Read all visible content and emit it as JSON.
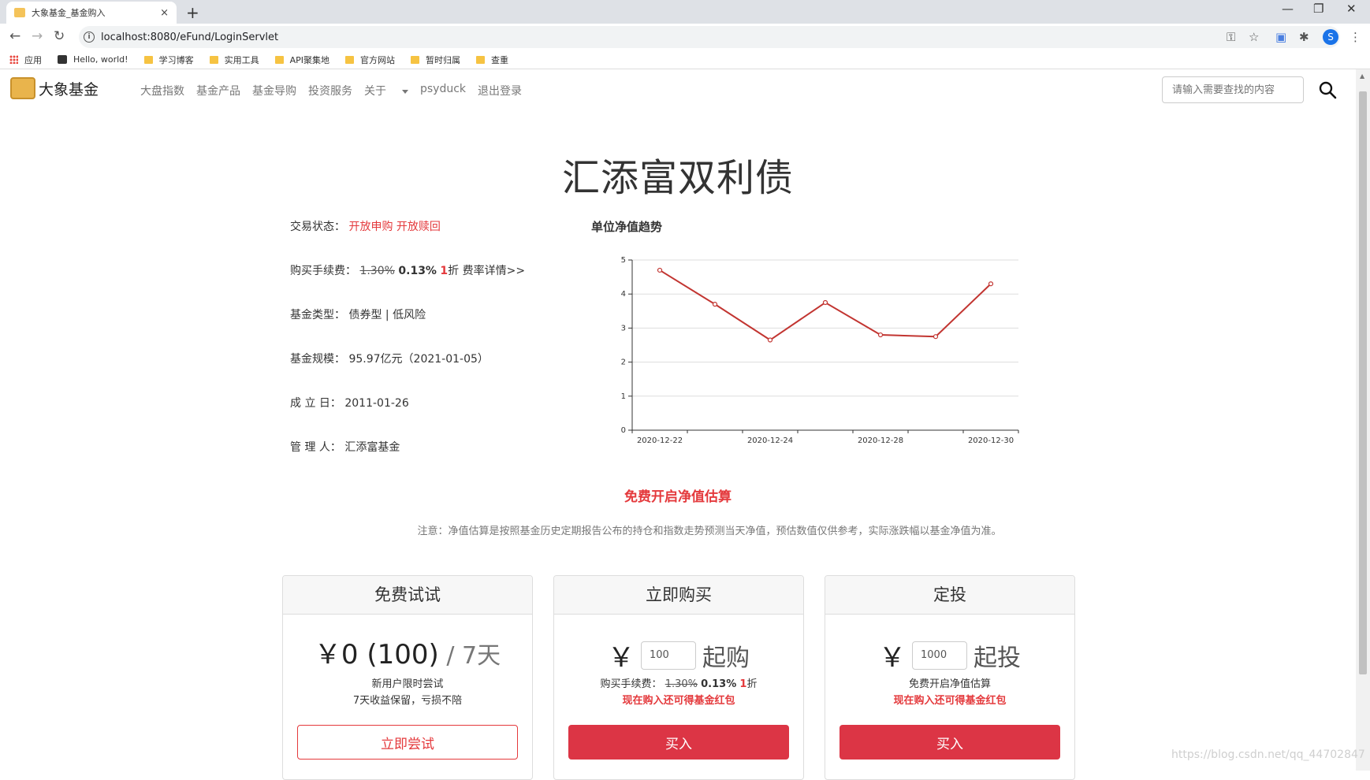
{
  "browser": {
    "tab_title": "大象基金_基金购入",
    "tab_close": "×",
    "new_tab": "+",
    "url": "localhost:8080/eFund/LoginServlet",
    "window_controls": [
      "—",
      "❐",
      "✕"
    ],
    "profile_initial": "S",
    "bookmarks": [
      "应用",
      "Hello, world!",
      "学习博客",
      "实用工具",
      "API聚集地",
      "官方网站",
      "暂时归属",
      "查重"
    ]
  },
  "site": {
    "logo_text": "大象基金",
    "nav": [
      "大盘指数",
      "基金产品",
      "基金导购",
      "投资服务",
      "关于",
      "psyduck",
      "退出登录"
    ],
    "search_placeholder": "请输入需要查找的内容"
  },
  "fund": {
    "name": "汇添富双利债",
    "status_label": "交易状态：",
    "status_value": "开放申购 开放赎回",
    "fee_label": "购买手续费：",
    "fee_original": "1.30%",
    "fee_discounted": "0.13%",
    "fee_discount_num": "1",
    "fee_discount_unit": "折",
    "fee_link": "费率详情>>",
    "type_label": "基金类型：",
    "type_value": "债券型 | 低风险",
    "size_label": "基金规模：",
    "size_value": "95.97亿元（2021-01-05）",
    "founded_label": "成 立 日：",
    "founded_value": "2011-01-26",
    "manager_label": "管 理 人：",
    "manager_value": "汇添富基金"
  },
  "chart_data": {
    "type": "line",
    "title": "单位净值趋势",
    "x": [
      "2020-12-22",
      "2020-12-23",
      "2020-12-24",
      "2020-12-25",
      "2020-12-28",
      "2020-12-29",
      "2020-12-30"
    ],
    "x_tick_labels": [
      "2020-12-22",
      "2020-12-24",
      "2020-12-28",
      "2020-12-30"
    ],
    "series": [
      {
        "values": [
          4.7,
          3.7,
          2.65,
          3.75,
          2.8,
          2.75,
          4.3
        ]
      }
    ],
    "ylim": [
      0,
      5
    ],
    "y_ticks": [
      0,
      1,
      2,
      3,
      4,
      5
    ],
    "grid": true,
    "line_color": "#c23531"
  },
  "promo": {
    "title": "免费开启净值估算",
    "note": "注意：净值估算是按照基金历史定期报告公布的持仓和指数走势预测当天净值，预估数值仅供参考，实际涨跌幅以基金净值为准。"
  },
  "cards": {
    "trial": {
      "header": "免费试试",
      "price": "￥0 (100)",
      "period": " / 7天",
      "line1": "新用户限时尝试",
      "line2": "7天收益保留，亏损不陪",
      "button": "立即尝试"
    },
    "buy": {
      "header": "立即购买",
      "currency": "￥",
      "input_value": "100",
      "suffix": "起购",
      "line1_label": "购买手续费：",
      "line1_original": "1.30%",
      "line1_discounted": "0.13%",
      "line1_discount_num": "1",
      "line1_discount_unit": "折",
      "line2": "现在购入还可得基金红包",
      "button": "买入"
    },
    "plan": {
      "header": "定投",
      "currency": "￥",
      "input_value": "1000",
      "suffix": "起投",
      "line1": "免费开启净值估算",
      "line2": "现在购入还可得基金红包",
      "button": "买入"
    }
  },
  "watermark": "https://blog.csdn.net/qq_44702847"
}
